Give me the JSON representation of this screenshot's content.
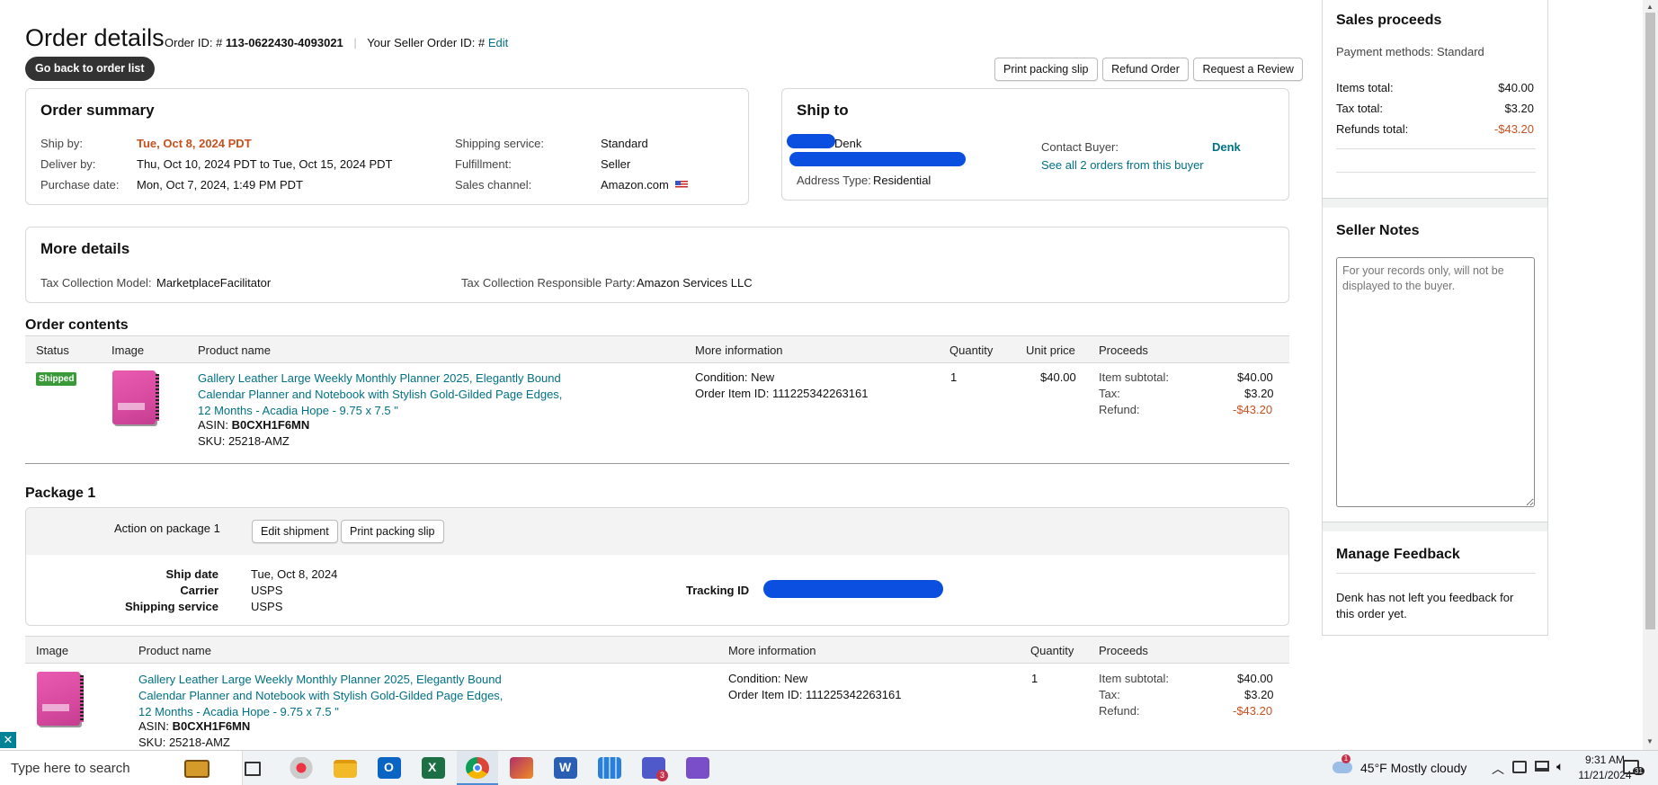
{
  "header": {
    "title": "Order details",
    "order_id_label": "Order ID: #",
    "order_id": "113-0622430-4093021",
    "seller_order_label": "Your Seller Order ID: #",
    "edit_label": "Edit",
    "back_button": "Go back to order list",
    "actions": [
      "Print packing slip",
      "Refund Order",
      "Request a Review"
    ]
  },
  "summary": {
    "title": "Order summary",
    "ship_by_label": "Ship by:",
    "ship_by": "Tue, Oct 8, 2024 PDT",
    "deliver_by_label": "Deliver by:",
    "deliver_by": "Thu, Oct 10, 2024 PDT to Tue, Oct 15, 2024 PDT",
    "purchase_date_label": "Purchase date:",
    "purchase_date": "Mon, Oct 7, 2024, 1:49 PM PDT",
    "shipping_service_label": "Shipping service:",
    "shipping_service": "Standard",
    "fulfillment_label": "Fulfillment:",
    "fulfillment": "Seller",
    "sales_channel_label": "Sales channel:",
    "sales_channel": "Amazon.com"
  },
  "ship_to": {
    "title": "Ship to",
    "name": "Denk",
    "address_type_label": "Address Type:",
    "address_type": "Residential",
    "contact_label": "Contact Buyer:",
    "contact_name": "Denk",
    "see_all": "See all 2 orders from this buyer"
  },
  "more_details": {
    "title": "More details",
    "tax_model_label": "Tax Collection Model:",
    "tax_model": "MarketplaceFacilitator",
    "tax_party_label": "Tax Collection Responsible Party:",
    "tax_party": "Amazon Services LLC"
  },
  "order_contents": {
    "title": "Order contents",
    "columns": [
      "Status",
      "Image",
      "Product name",
      "More information",
      "Quantity",
      "Unit price",
      "Proceeds"
    ],
    "status_badge": "Shipped",
    "product_line1": "Gallery Leather Large Weekly Monthly Planner 2025, Elegantly Bound",
    "product_line2": "Calendar Planner and Notebook with Stylish Gold-Gilded Page Edges,",
    "product_line3": "12 Months - Acadia Hope - 9.75 x 7.5 \"",
    "asin_label": "ASIN:",
    "asin": "B0CXH1F6MN",
    "sku": "SKU: 25218-AMZ",
    "condition": "Condition: New",
    "order_item_id": "Order Item ID: 111225342263161",
    "quantity": "1",
    "unit_price": "$40.00",
    "item_subtotal_label": "Item subtotal:",
    "item_subtotal": "$40.00",
    "tax_label": "Tax:",
    "tax": "$3.20",
    "refund_label": "Refund:",
    "refund": "-$43.20"
  },
  "package": {
    "title": "Package 1",
    "action_label": "Action on package 1",
    "edit_shipment": "Edit shipment",
    "print_slip": "Print packing slip",
    "ship_date_label": "Ship date",
    "ship_date": "Tue, Oct 8, 2024",
    "carrier_label": "Carrier",
    "carrier": "USPS",
    "service_label": "Shipping service",
    "service": "USPS",
    "tracking_label": "Tracking ID",
    "columns": [
      "Image",
      "Product name",
      "More information",
      "Quantity",
      "Proceeds"
    ]
  },
  "sidebar": {
    "proceeds_title": "Sales proceeds",
    "payment_methods": "Payment methods: Standard",
    "items_total_label": "Items total:",
    "items_total": "$40.00",
    "tax_total_label": "Tax total:",
    "tax_total": "$3.20",
    "refunds_total_label": "Refunds total:",
    "refunds_total": "-$43.20",
    "notes_title": "Seller Notes",
    "notes_placeholder": "For your records only, will not be displayed to the buyer.",
    "feedback_title": "Manage Feedback",
    "feedback_text_1": "Denk has not left you feedback for",
    "feedback_text_2": "this order yet."
  },
  "taskbar": {
    "search_placeholder": "Type here to search",
    "weather": "45°F  Mostly cloudy",
    "time": "9:31 AM",
    "date": "11/21/2024",
    "teams_badge": "3",
    "notification_count": "31",
    "weather_badge": "1"
  }
}
